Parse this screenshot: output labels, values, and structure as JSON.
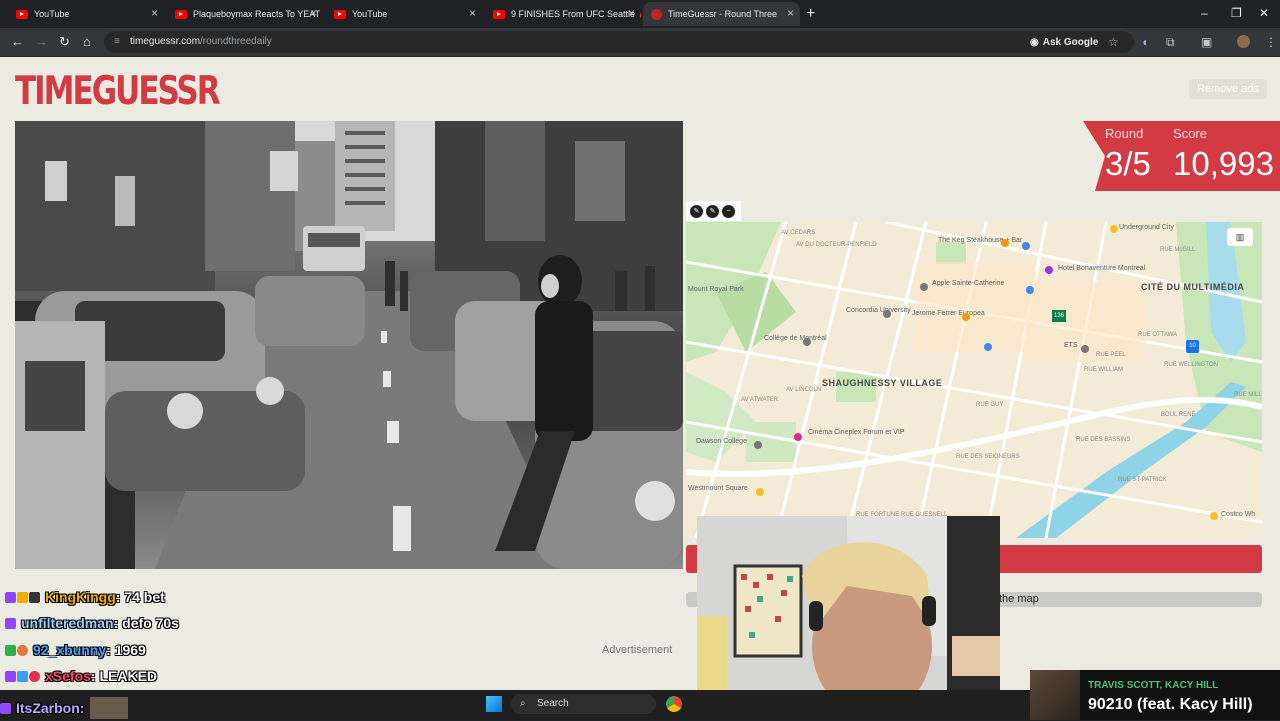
{
  "browser": {
    "tabs": [
      {
        "label": "YouTube"
      },
      {
        "label": "Plaqueboymax Reacts To YEAT"
      },
      {
        "label": "YouTube"
      },
      {
        "label": "9 FINISHES From UFC Seattle 🩸"
      },
      {
        "label": "TimeGuessr - Round Three"
      }
    ],
    "url_domain": "timeguessr.com",
    "url_path": "/roundthreedaily",
    "ask_google": "Ask Google"
  },
  "page": {
    "logo": "TIMEGUESSR",
    "remove_ads": "Remove ads",
    "round_label": "Round",
    "round_value": "3/5",
    "score_label": "Score",
    "score_value": "10,993",
    "show_map_text": "the map",
    "advertisement": "Advertisement",
    "accent_color": "#d33b44"
  },
  "map": {
    "labels": {
      "mount_royal": "Mount Royal Park",
      "keg": "The Keg Steakhouse + Bar",
      "hotel": "Hotel Bonaventure Montreal",
      "underground": "Underground City",
      "cite": "CITÉ DU MULTIMÉDIA",
      "apple": "Apple Sainte-Catherine",
      "concordia": "Concordia University",
      "jerome": "Jerome Ferrer Europea",
      "college": "Collège de Montréal",
      "ets": "ETS",
      "shaughnessy": "SHAUGHNESSY VILLAGE",
      "cinema": "Cinéma Cineplex Forum et VIP",
      "dawson": "Dawson College",
      "westmount": "Westmount Square",
      "costco": "Costco Wh",
      "rue_peel": "RUE PEEL",
      "rue_guy": "RUE GUY",
      "rue_atwater": "AV ATWATER",
      "rue_lincoln": "AV LINCOLN",
      "rue_seigneurs": "RUE DES SEIGNEURS",
      "rue_bassins": "RUE DES BASSINS",
      "rue_st_patrick": "RUE ST-PATRICK",
      "rue_ottawa": "RUE OTTAWA",
      "rue_william": "RUE WILLIAM",
      "rue_wellington": "RUE WELLINGTON",
      "rue_mill": "RUE MILL",
      "rue_mcgill": "RUE McGILL",
      "av_docteur": "AV DU DOCTEUR-PENFIELD",
      "rue_guesnell": "RUE GUESNELL",
      "rue_fortune": "RUE FORTUNE",
      "boul_rene": "BOUL RENÉ",
      "av_cedars": "AV CEDARS"
    },
    "shield_10": "10",
    "shield_136": "136"
  },
  "chat": [
    {
      "name": "KingKingg",
      "message": "74 bet",
      "color": "#f0b000"
    },
    {
      "name": "unfilteredman",
      "message": "defo 70s",
      "color": "#9ad0ff"
    },
    {
      "name": "92_xbunny",
      "message": "1969",
      "color": "#4aa3ff"
    },
    {
      "name": "xSefos",
      "message": "LEAKED",
      "color": "#ff4a6a"
    }
  ],
  "streamer": {
    "name": "ItsZarbon:"
  },
  "taskbar": {
    "search": "Search"
  },
  "now_playing": {
    "artist": "TRAVIS SCOTT, KACY HILL",
    "title": "90210 (feat. Kacy Hill)"
  }
}
